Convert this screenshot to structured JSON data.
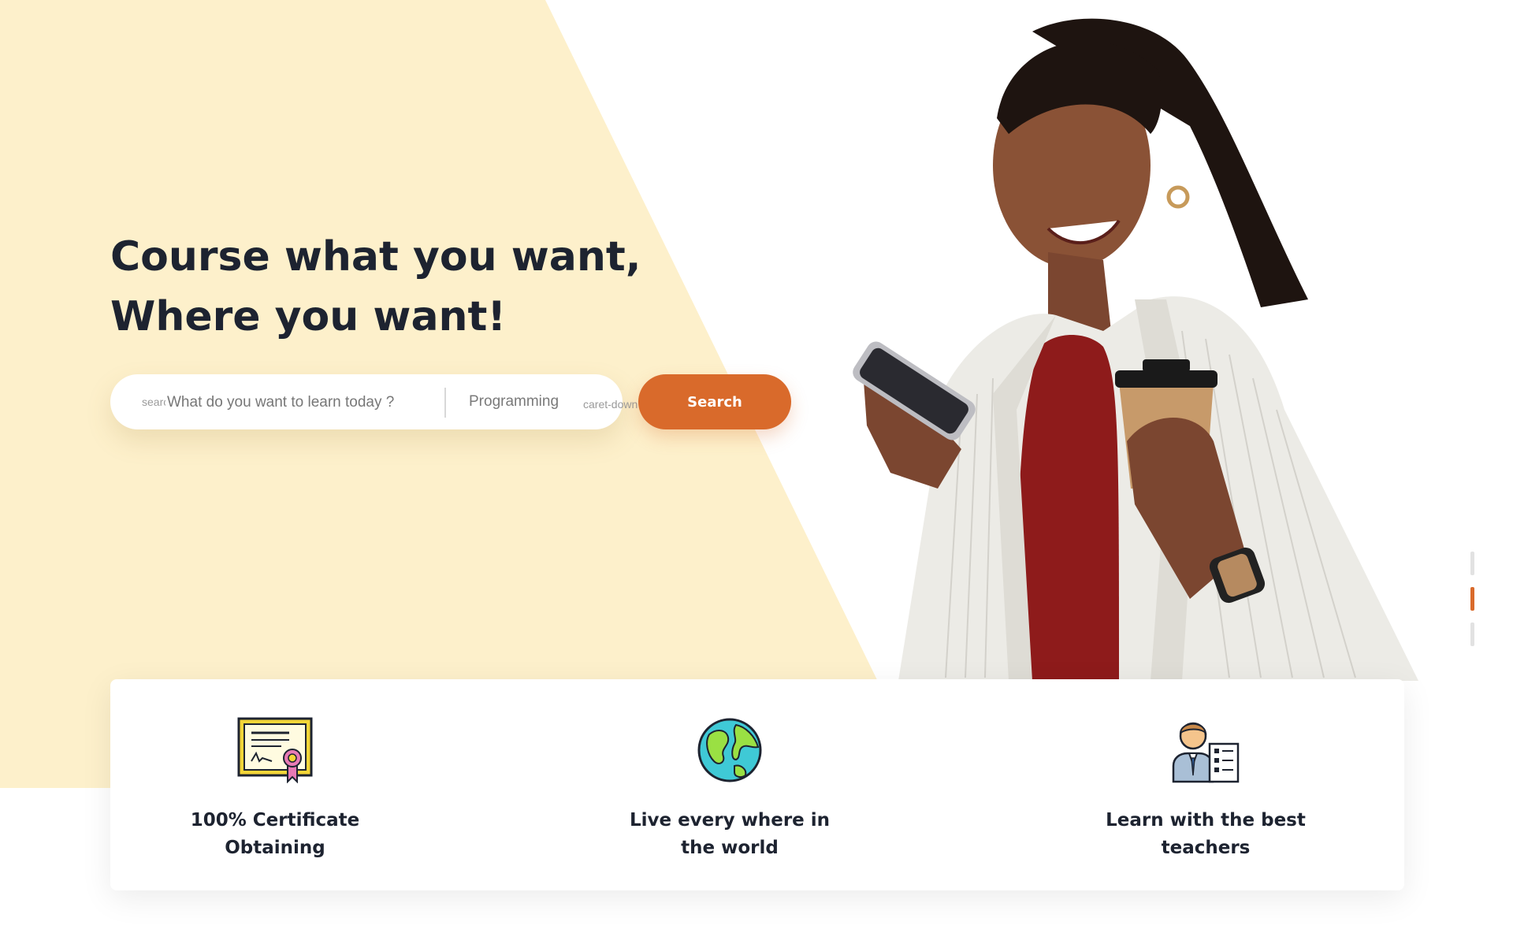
{
  "hero": {
    "title_line1": "Course what you want,",
    "title_line2": "Where you want!"
  },
  "search": {
    "icon_label": "search",
    "placeholder": "What do you want to learn today ?",
    "category": "Programming",
    "caret_label": "caret-down",
    "button_label": "Search"
  },
  "features": [
    {
      "label_line1": "100% Certificate",
      "label_line2": "Obtaining",
      "icon": "certificate-icon"
    },
    {
      "label_line1": "Live every where in",
      "label_line2": "the world",
      "icon": "globe-icon"
    },
    {
      "label_line1": "Learn with the best",
      "label_line2": "teachers",
      "icon": "teacher-icon"
    }
  ],
  "colors": {
    "hero_bg": "#fdf0cb",
    "accent": "#d96a2b",
    "heading": "#1d2330"
  },
  "slider": {
    "active_index": 1,
    "count": 3
  }
}
